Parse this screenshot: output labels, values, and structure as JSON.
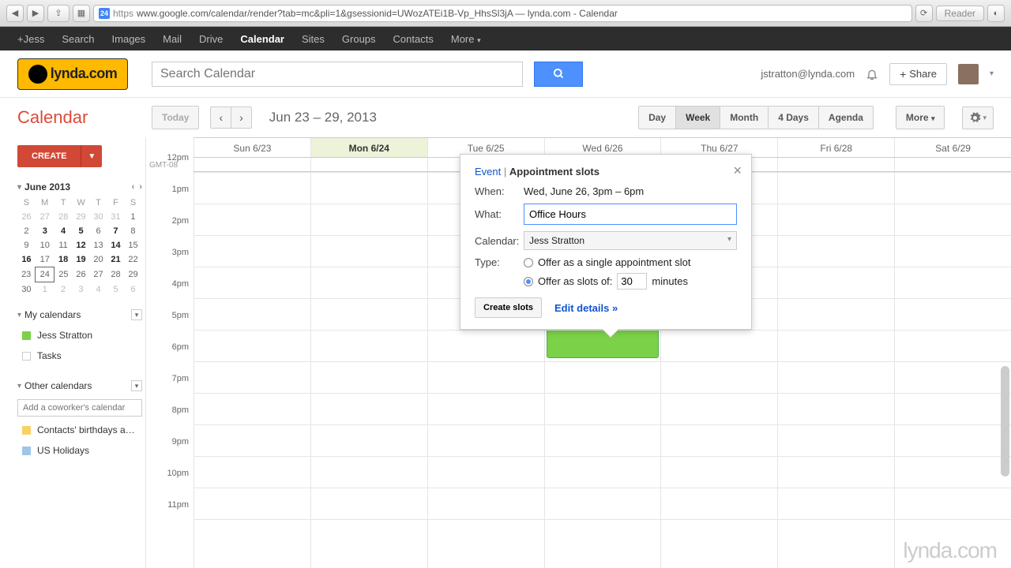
{
  "browser": {
    "url_prefix": "https",
    "url": "www.google.com/calendar/render?tab=mc&pli=1&gsessionid=UWozATEi1B-Vp_HhsSl3jA — lynda.com - Calendar",
    "reader": "Reader",
    "favicon_text": "24"
  },
  "nav": {
    "items": [
      "+Jess",
      "Search",
      "Images",
      "Mail",
      "Drive",
      "Calendar",
      "Sites",
      "Groups",
      "Contacts",
      "More"
    ],
    "active_index": 5
  },
  "logo_text": "lynda.com",
  "search_placeholder": "Search Calendar",
  "user": {
    "email": "jstratton@lynda.com",
    "share": "Share"
  },
  "toolbar": {
    "title": "Calendar",
    "today": "Today",
    "range": "Jun 23 – 29, 2013",
    "views": [
      "Day",
      "Week",
      "Month",
      "4 Days",
      "Agenda"
    ],
    "active_view": 1,
    "more": "More"
  },
  "create_label": "CREATE",
  "mini": {
    "month": "June 2013",
    "dow": [
      "S",
      "M",
      "T",
      "W",
      "T",
      "F",
      "S"
    ],
    "weeks": [
      [
        {
          "d": "26",
          "dim": true
        },
        {
          "d": "27",
          "dim": true
        },
        {
          "d": "28",
          "dim": true
        },
        {
          "d": "29",
          "dim": true
        },
        {
          "d": "30",
          "dim": true
        },
        {
          "d": "31",
          "dim": true
        },
        {
          "d": "1"
        }
      ],
      [
        {
          "d": "2"
        },
        {
          "d": "3",
          "bold": true
        },
        {
          "d": "4",
          "bold": true
        },
        {
          "d": "5",
          "bold": true
        },
        {
          "d": "6"
        },
        {
          "d": "7",
          "bold": true
        },
        {
          "d": "8"
        }
      ],
      [
        {
          "d": "9"
        },
        {
          "d": "10"
        },
        {
          "d": "11"
        },
        {
          "d": "12",
          "bold": true
        },
        {
          "d": "13"
        },
        {
          "d": "14",
          "bold": true
        },
        {
          "d": "15"
        }
      ],
      [
        {
          "d": "16",
          "bold": true
        },
        {
          "d": "17"
        },
        {
          "d": "18",
          "bold": true
        },
        {
          "d": "19",
          "bold": true
        },
        {
          "d": "20"
        },
        {
          "d": "21",
          "bold": true
        },
        {
          "d": "22"
        }
      ],
      [
        {
          "d": "23"
        },
        {
          "d": "24",
          "today": true
        },
        {
          "d": "25"
        },
        {
          "d": "26"
        },
        {
          "d": "27"
        },
        {
          "d": "28"
        },
        {
          "d": "29"
        }
      ],
      [
        {
          "d": "30"
        },
        {
          "d": "1",
          "dim": true
        },
        {
          "d": "2",
          "dim": true
        },
        {
          "d": "3",
          "dim": true
        },
        {
          "d": "4",
          "dim": true
        },
        {
          "d": "5",
          "dim": true
        },
        {
          "d": "6",
          "dim": true
        }
      ]
    ]
  },
  "my_calendars": {
    "title": "My calendars",
    "items": [
      {
        "name": "Jess Stratton",
        "color": "green"
      },
      {
        "name": "Tasks",
        "color": "empty"
      }
    ]
  },
  "other_calendars": {
    "title": "Other calendars",
    "add_placeholder": "Add a coworker's calendar",
    "items": [
      {
        "name": "Contacts' birthdays a…",
        "color": "yellow"
      },
      {
        "name": "US Holidays",
        "color": "blue"
      }
    ]
  },
  "grid": {
    "tz": "GMT-08",
    "hours": [
      "12pm",
      "1pm",
      "2pm",
      "3pm",
      "4pm",
      "5pm",
      "6pm",
      "7pm",
      "8pm",
      "9pm",
      "10pm",
      "11pm"
    ],
    "days": [
      "Sun 6/23",
      "Mon 6/24",
      "Tue 6/25",
      "Wed 6/26",
      "Thu 6/27",
      "Fri 6/28",
      "Sat 6/29"
    ],
    "active_day": 1
  },
  "popup": {
    "event_tab": "Event",
    "slots_tab": "Appointment slots",
    "when_label": "When:",
    "when_value": "Wed, June 26, 3pm – 6pm",
    "what_label": "What:",
    "what_value": "Office Hours",
    "calendar_label": "Calendar:",
    "calendar_value": "Jess Stratton",
    "type_label": "Type:",
    "type_single": "Offer as a single appointment slot",
    "type_slots": "Offer as slots of:",
    "slot_minutes": "30",
    "minutes_label": "minutes",
    "create_button": "Create slots",
    "edit_link": "Edit details »"
  },
  "watermark": "lynda.com"
}
